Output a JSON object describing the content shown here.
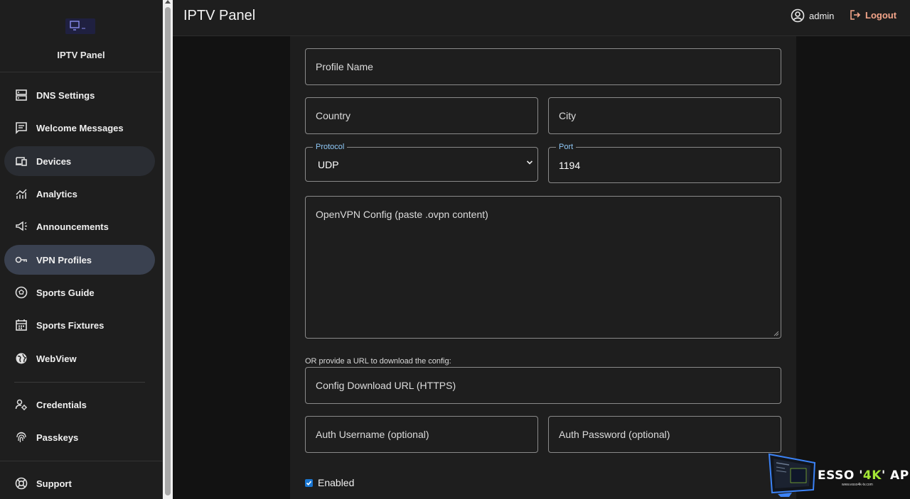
{
  "brand": {
    "title": "IPTV Panel"
  },
  "sidebar": {
    "items": [
      {
        "label": "DNS Settings",
        "icon": "dns-icon"
      },
      {
        "label": "Welcome Messages",
        "icon": "message-icon"
      },
      {
        "label": "Devices",
        "icon": "devices-icon"
      },
      {
        "label": "Analytics",
        "icon": "analytics-icon"
      },
      {
        "label": "Announcements",
        "icon": "megaphone-icon"
      },
      {
        "label": "VPN Profiles",
        "icon": "key-icon"
      },
      {
        "label": "Sports Guide",
        "icon": "soccer-ball-icon"
      },
      {
        "label": "Sports Fixtures",
        "icon": "calendar-icon"
      },
      {
        "label": "WebView",
        "icon": "globe-icon"
      },
      {
        "label": "Credentials",
        "icon": "user-cog-icon"
      },
      {
        "label": "Passkeys",
        "icon": "fingerprint-icon"
      },
      {
        "label": "Support",
        "icon": "lifebuoy-icon"
      }
    ],
    "active": "VPN Profiles",
    "hovered": "Devices"
  },
  "header": {
    "title": "IPTV Panel",
    "user": "admin",
    "logout_label": "Logout"
  },
  "form": {
    "profile_name_placeholder": "Profile Name",
    "country_placeholder": "Country",
    "city_placeholder": "City",
    "protocol_label": "Protocol",
    "protocol_value": "UDP",
    "port_label": "Port",
    "port_value": "1194",
    "config_placeholder": "OpenVPN Config (paste .ovpn content)",
    "url_hint": "OR provide a URL to download the config:",
    "config_url_placeholder": "Config Download URL (HTTPS)",
    "auth_username_placeholder": "Auth Username (optional)",
    "auth_password_placeholder": "Auth Password (optional)",
    "enabled_label": "Enabled",
    "enabled": true
  },
  "watermark": {
    "text_pre": "ESSO '",
    "text_hl": "4K",
    "text_post": "' APPS",
    "url": "www.esso4k-tv.com"
  },
  "colors": {
    "accent": "#90caf9",
    "active_nav": "#3a4150",
    "logout": "#f4a58a",
    "checkbox": "#1976d2"
  }
}
